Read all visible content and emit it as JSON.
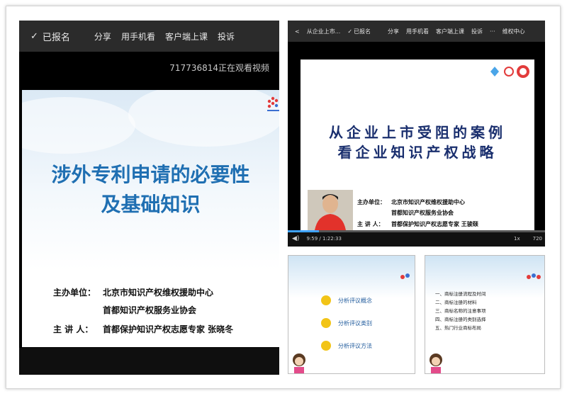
{
  "main_player": {
    "topbar": {
      "registered": "已报名",
      "share": "分享",
      "mobile": "用手机看",
      "client": "客户端上课",
      "complaint": "投诉"
    },
    "viewer_notice": "717736814正在观看视频",
    "slide": {
      "title_line1": "涉外专利申请的必要性",
      "title_line2": "及基础知识",
      "organizer_label": "主办单位：",
      "organizer_1": "北京市知识产权维权援助中心",
      "organizer_2": "首都知识产权服务业协会",
      "speaker_label": "主  讲 人：",
      "speaker": "首都保护知识产权志愿专家  张晓冬"
    }
  },
  "second_player": {
    "topbar": {
      "back": "<",
      "course": "从企业上市...",
      "registered": "已报名",
      "share": "分享",
      "mobile": "用手机看",
      "client": "客户端上课",
      "complaint": "投诉",
      "more": "···",
      "rights": "维权中心"
    },
    "slide": {
      "title_line1": "从企业上市受阻的案例",
      "title_line2": "看企业知识产权战略",
      "organizer_label": "主办单位：",
      "organizer_1": "北京市知识产权维权援助中心",
      "organizer_2": "首都知识产权服务业协会",
      "speaker_label": "主  讲 人：",
      "speaker": "首都保护知识产权志愿专家  王骏颐"
    },
    "time": "9:59 / 1:22:33",
    "progress_fraction": 0.12,
    "speed": "1x",
    "quality": "720"
  },
  "slide_three": {
    "bullets": [
      "分析评议概念",
      "分析评议类别",
      "分析评议方法"
    ]
  },
  "slide_four": {
    "items": [
      "一、商标注册流程及时间",
      "二、商标注册的材料",
      "三、商标名称的注意事项",
      "四、商标注册的类别选择",
      "五、热门行业商标布局"
    ]
  },
  "colors": {
    "title_blue": "#1f6fb2",
    "title_navy": "#1a2f6e",
    "bullet_yellow": "#f2c417",
    "progress_blue": "#3fa3ff"
  }
}
